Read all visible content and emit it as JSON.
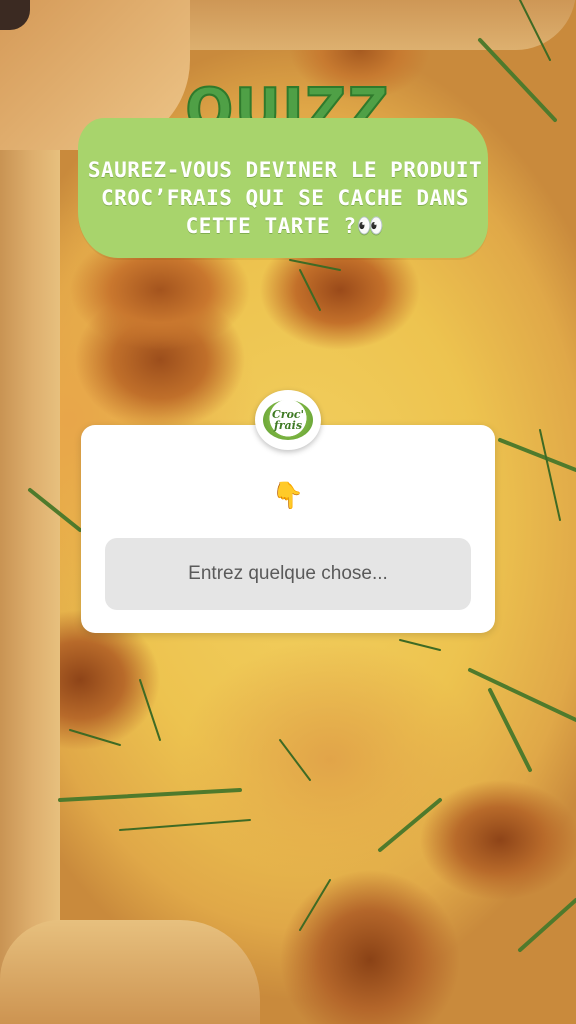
{
  "quiz": {
    "title": "QUIZZ",
    "question_line1": "SAUREZ-VOUS DEVINER LE PRODUIT",
    "question_line2": "CROC’FRAIS QUI SE CACHE DANS",
    "question_line3": "CETTE TARTE ?",
    "question_emoji": "👀"
  },
  "brand": {
    "logo_line1": "Croc'",
    "logo_line2": "frais"
  },
  "answer_card": {
    "pointer_emoji": "👇",
    "input_placeholder": "Entrez quelque chose...",
    "input_value": ""
  },
  "colors": {
    "title_green": "#4fa046",
    "bubble_green": "#a8d46c",
    "card_white": "#ffffff",
    "input_gray": "#e5e5e5"
  },
  "background": {
    "icon": "quiche-tart-photo"
  }
}
